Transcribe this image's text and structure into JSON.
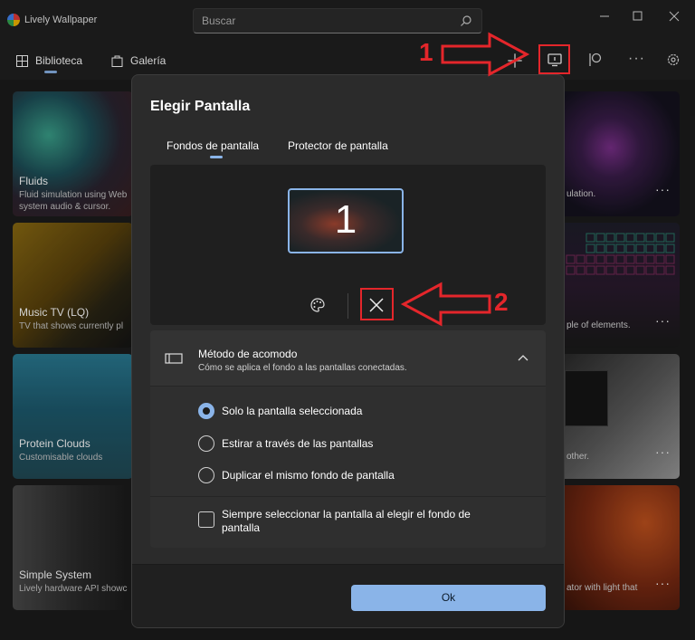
{
  "app": {
    "title": "Lively Wallpaper"
  },
  "search": {
    "placeholder": "Buscar"
  },
  "nav": {
    "library": "Biblioteca",
    "gallery": "Galería"
  },
  "cards_left": [
    {
      "title": "Fluids",
      "desc1": "Fluid simulation using Web",
      "desc2": "system audio & cursor."
    },
    {
      "title": "Music TV (LQ)",
      "desc1": "TV that shows currently pl",
      "desc2": ""
    },
    {
      "title": "Protein Clouds",
      "desc1": "Customisable clouds",
      "desc2": ""
    },
    {
      "title": "Simple System",
      "desc1": "Lively hardware API showc",
      "desc2": ""
    }
  ],
  "cards_right": [
    {
      "desc": "ulation."
    },
    {
      "desc": "ple of elements."
    },
    {
      "desc": "other."
    },
    {
      "desc": "ator with light that"
    }
  ],
  "dialog": {
    "title": "Elegir Pantalla",
    "tabs": [
      "Fondos de pantalla",
      "Protector de pantalla"
    ],
    "monitor_number": "1",
    "arrangement": {
      "title": "Método de acomodo",
      "subtitle": "Cómo se aplica el fondo a las pantallas conectadas.",
      "options": [
        "Solo la pantalla seleccionada",
        "Estirar a través de las pantallas",
        "Duplicar el mismo fondo de pantalla"
      ],
      "selected": "Solo la pantalla seleccionada"
    },
    "checkbox": {
      "line1": "Siempre seleccionar la pantalla al elegir el fondo de",
      "line2": "pantalla",
      "checked": false
    },
    "ok": "Ok"
  },
  "annotations": {
    "one": "1",
    "two": "2"
  },
  "colors": {
    "accent": "#8ab4e8",
    "annotation": "#e4262b"
  }
}
